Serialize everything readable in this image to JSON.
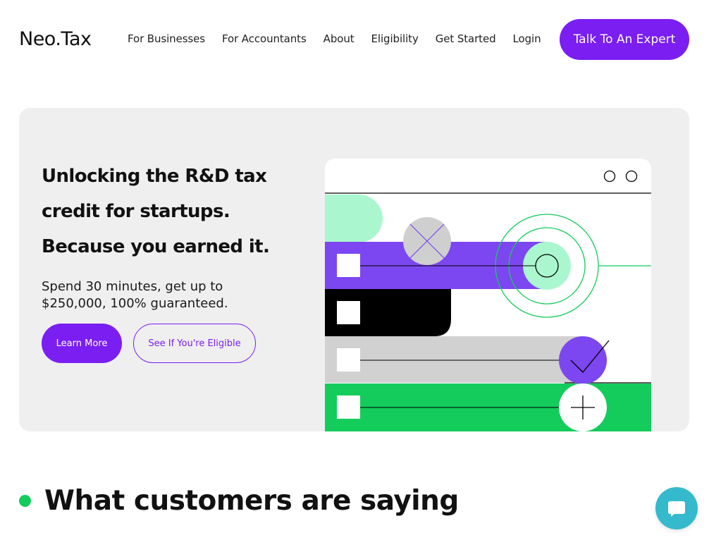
{
  "brand": {
    "logo_text": "Neo.Tax"
  },
  "nav": {
    "items": [
      {
        "label": "For Businesses"
      },
      {
        "label": "For Accountants"
      },
      {
        "label": "About"
      },
      {
        "label": "Eligibility"
      },
      {
        "label": "Get Started"
      },
      {
        "label": "Login"
      }
    ],
    "cta_label": "Talk To An Expert"
  },
  "hero": {
    "title_lines": [
      "Unlocking the R&D tax",
      "credit for startups.",
      "Because you earned it."
    ],
    "subtitle_lines": [
      "Spend 30 minutes, get up to",
      "$250,000, 100% guaranteed."
    ],
    "primary_button": "Learn More",
    "secondary_button": "See If You're Eligible"
  },
  "testimonials": {
    "heading": "What customers are saying"
  },
  "colors": {
    "brand_purple": "#7a1ef2",
    "illustration_purple": "#7c47f0",
    "mint": "#aaf7cf",
    "green": "#14cc5c",
    "hero_bg": "#efefef",
    "chat_teal": "#35b9cc"
  },
  "icons": {
    "chat": "chat-bubble-icon",
    "check": "checkmark-icon",
    "plus": "plus-icon",
    "close": "x-mark-icon"
  }
}
